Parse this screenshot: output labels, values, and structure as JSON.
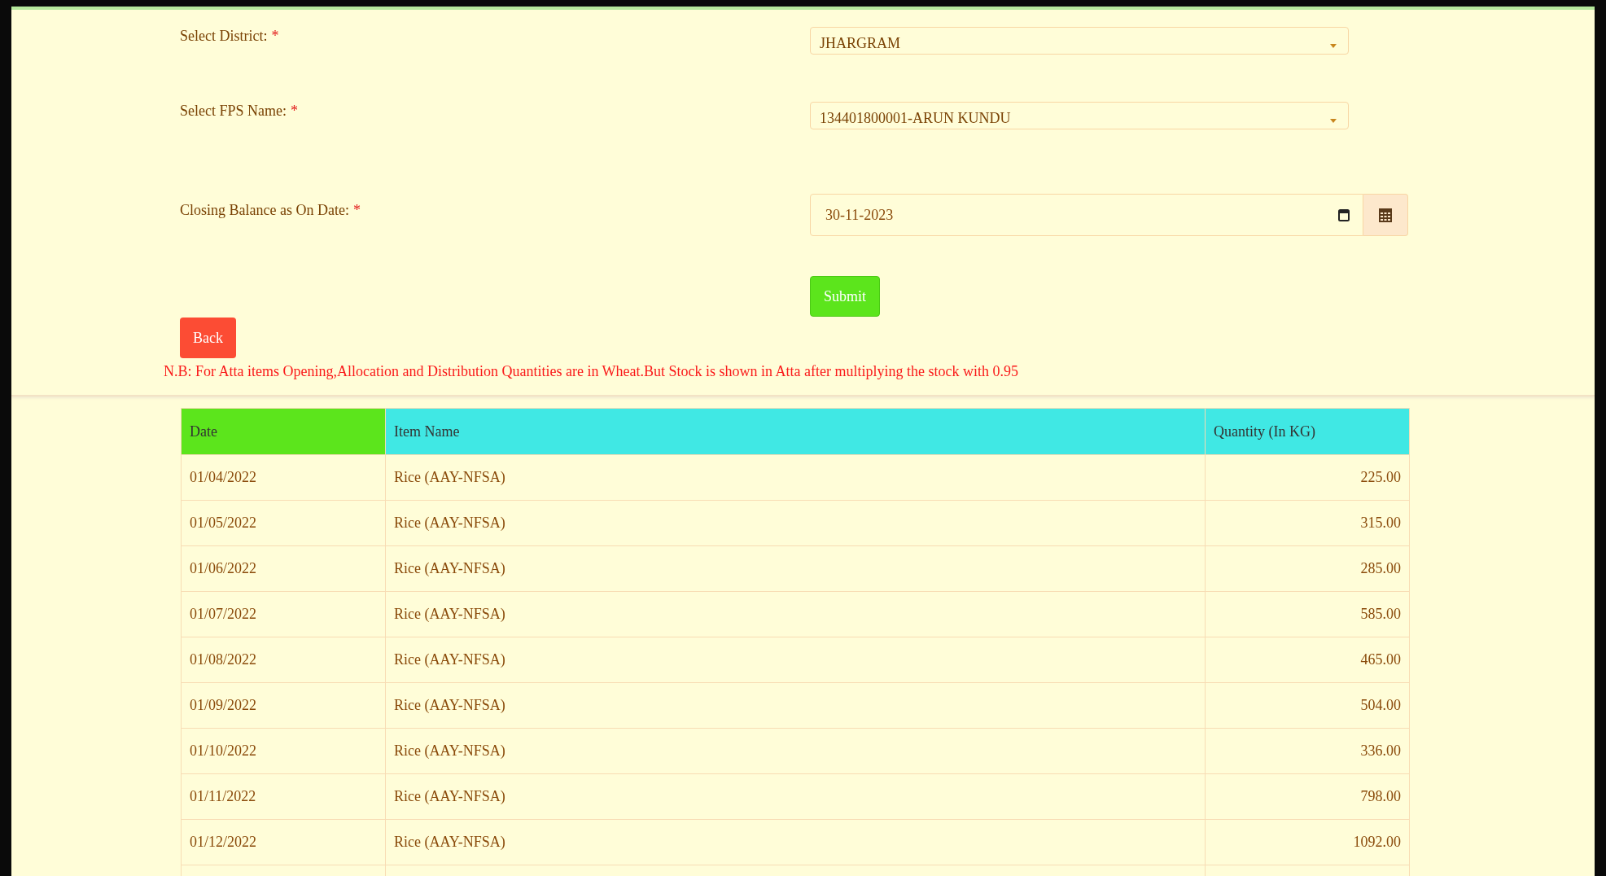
{
  "form": {
    "fields": [
      {
        "kind": "select",
        "label": "Select District:",
        "required_mark": "*",
        "value": "JHARGRAM"
      },
      {
        "kind": "select",
        "label": "Select FPS Name:",
        "required_mark": "*",
        "value": "134401800001-ARUN KUNDU"
      },
      {
        "kind": "date",
        "label": "Closing Balance as On Date:",
        "required_mark": "*",
        "value": "30-11-2023"
      }
    ],
    "submit": "Submit",
    "back": "Back",
    "note": "N.B: For Atta items Opening,Allocation and Distribution Quantities are in Wheat.But Stock is shown in Atta after multiplying the stock with 0.95"
  },
  "table": {
    "columns": [
      {
        "label": "Date",
        "color": "#5ce51c"
      },
      {
        "label": "Item Name",
        "color": "#40e8e4"
      },
      {
        "label": "Quantity (In KG)",
        "color": "#40e8e4"
      }
    ],
    "rows": [
      [
        "01/04/2022",
        "Rice (AAY-NFSA)",
        "225.00"
      ],
      [
        "01/05/2022",
        "Rice (AAY-NFSA)",
        "315.00"
      ],
      [
        "01/06/2022",
        "Rice (AAY-NFSA)",
        "285.00"
      ],
      [
        "01/07/2022",
        "Rice (AAY-NFSA)",
        "585.00"
      ],
      [
        "01/08/2022",
        "Rice (AAY-NFSA)",
        "465.00"
      ],
      [
        "01/09/2022",
        "Rice (AAY-NFSA)",
        "504.00"
      ],
      [
        "01/10/2022",
        "Rice (AAY-NFSA)",
        "336.00"
      ],
      [
        "01/11/2022",
        "Rice (AAY-NFSA)",
        "798.00"
      ],
      [
        "01/12/2022",
        "Rice (AAY-NFSA)",
        "1092.00"
      ]
    ]
  }
}
